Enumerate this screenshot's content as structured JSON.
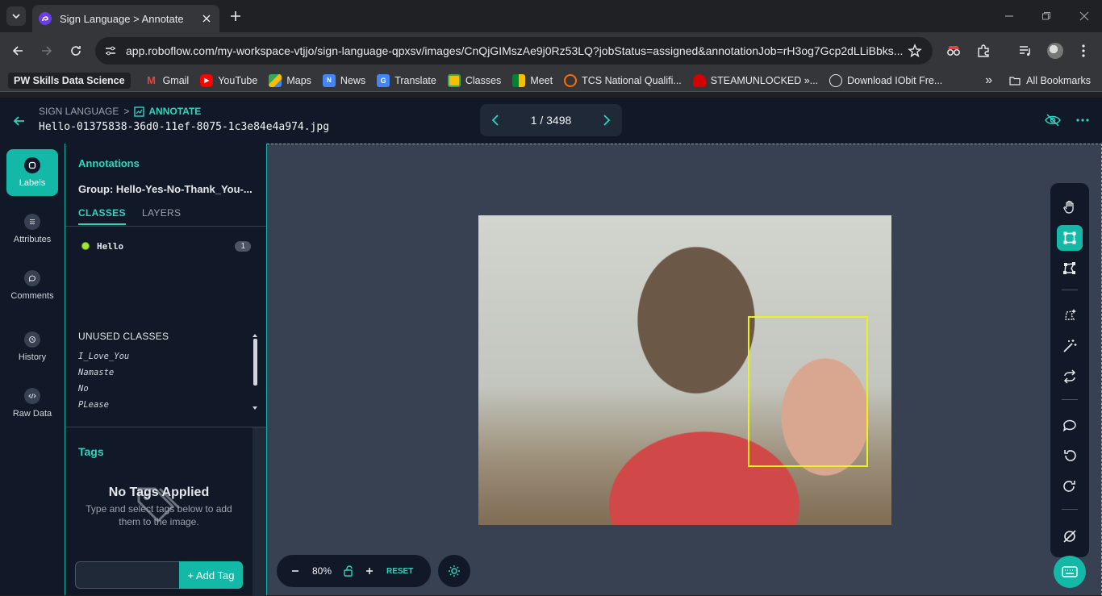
{
  "browser": {
    "tab_title": "Sign Language > Annotate",
    "url": "app.roboflow.com/my-workspace-vtjjo/sign-language-qpxsv/images/CnQjGIMszAe9j0Rz53LQ?jobStatus=assigned&annotationJob=rH3og7Gcp2dLLiBbks...",
    "bookmarks": [
      "PW Skills Data Science",
      "Gmail",
      "YouTube",
      "Maps",
      "News",
      "Translate",
      "Classes",
      "Meet",
      "TCS National Qualifi...",
      "STEAMUNLOCKED »...",
      "Download IObit Fre..."
    ],
    "all_bookmarks": "All Bookmarks",
    "overflow": "»"
  },
  "header": {
    "crumb_project": "SIGN LANGUAGE",
    "crumb_sep": ">",
    "crumb_active": "ANNOTATE",
    "filename": "Hello-01375838-36d0-11ef-8075-1c3e84e4a974.jpg",
    "pager": "1 / 3498"
  },
  "rail": {
    "labels": "Labels",
    "attributes": "Attributes",
    "comments": "Comments",
    "history": "History",
    "raw_data": "Raw Data"
  },
  "panel": {
    "title": "Annotations",
    "group": "Group: Hello-Yes-No-Thank_You-...",
    "tab_classes": "CLASSES",
    "tab_layers": "LAYERS",
    "classes": [
      {
        "name": "Hello",
        "count": "1",
        "color": "#a3e635"
      }
    ],
    "unused_title": "UNUSED CLASSES",
    "unused": [
      "I_Love_You",
      "Namaste",
      "No",
      "PLease"
    ],
    "tags_title": "Tags",
    "no_tags": "No Tags Applied",
    "no_tags_sub": "Type and select tags below to add them to the image.",
    "add_tag": "+ Add Tag"
  },
  "canvas": {
    "zoom": "80%",
    "reset": "RESET",
    "bbox_color": "#e8f31c"
  },
  "colors": {
    "accent": "#14b8a6",
    "accent_text": "#2dd4bf",
    "bg_dark": "#111827",
    "canvas_bg": "#374151"
  }
}
